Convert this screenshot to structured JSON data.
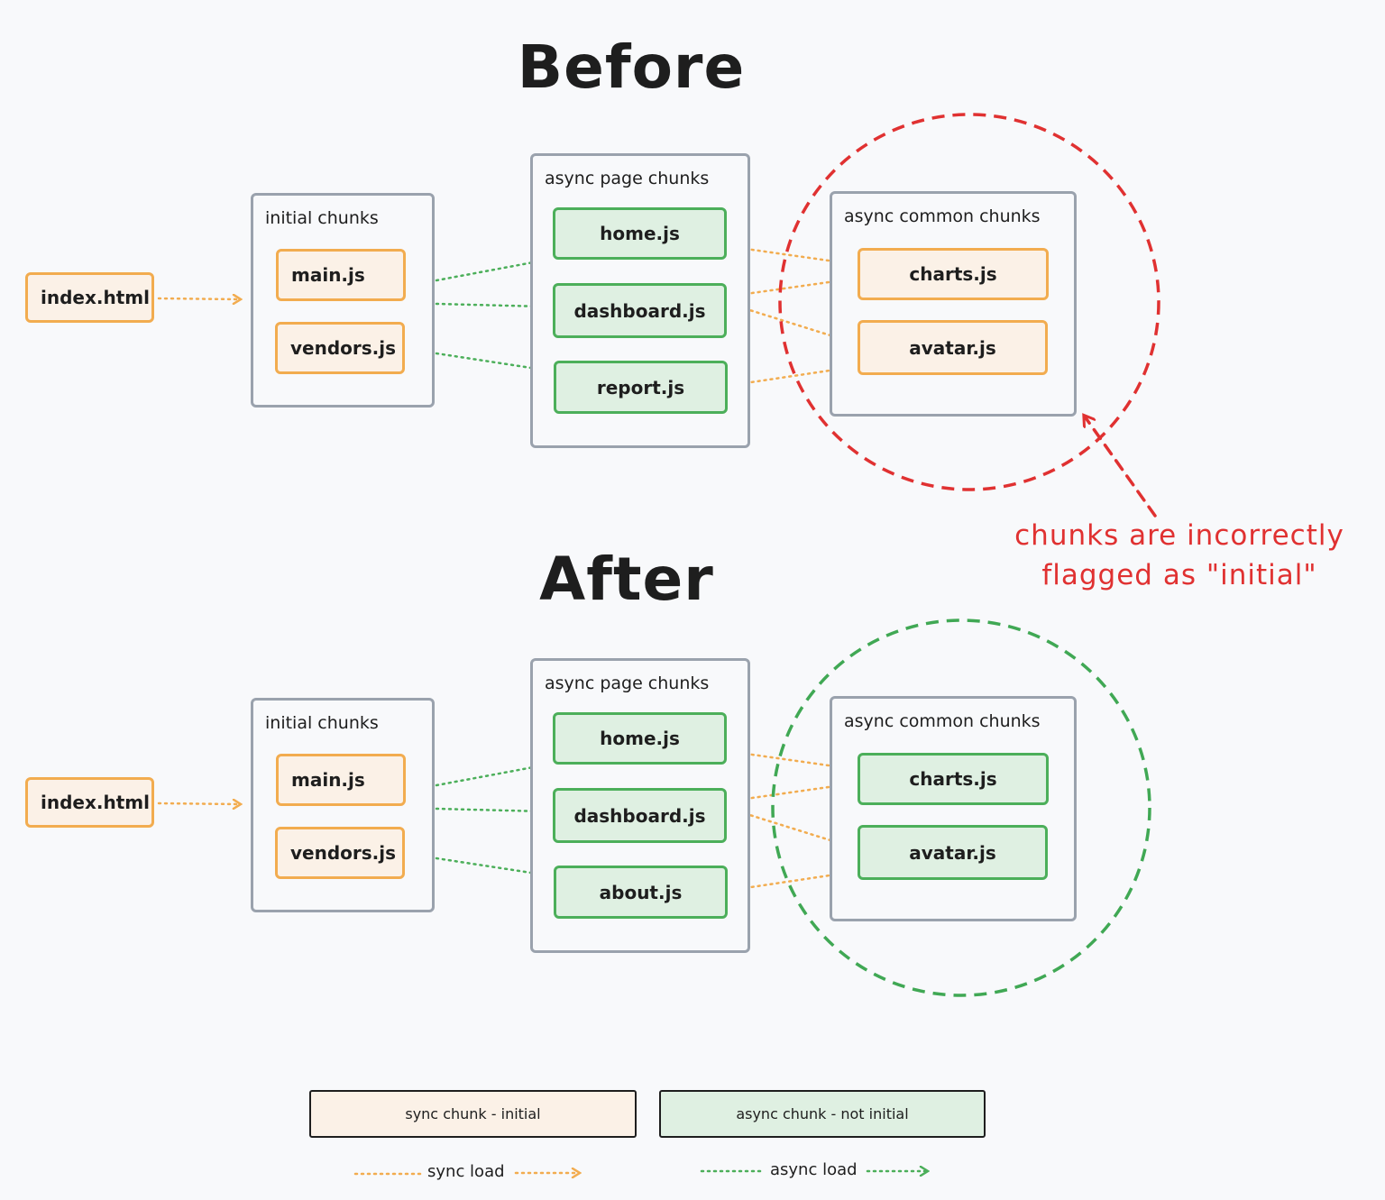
{
  "before": {
    "title": "Before",
    "entry": "index.html",
    "initial_group": {
      "label": "initial chunks",
      "chunks": [
        "main.js",
        "vendors.js"
      ]
    },
    "page_group": {
      "label": "async page chunks",
      "chunks": [
        "home.js",
        "dashboard.js",
        "report.js"
      ]
    },
    "common_group": {
      "label": "async common chunks",
      "chunks": [
        "charts.js",
        "avatar.js"
      ],
      "chunk_type": "sync"
    },
    "highlight_color": "#e03131",
    "annotation": {
      "line1": "chunks are incorrectly",
      "line2": "flagged as \"initial\""
    }
  },
  "after": {
    "title": "After",
    "entry": "index.html",
    "initial_group": {
      "label": "initial chunks",
      "chunks": [
        "main.js",
        "vendors.js"
      ]
    },
    "page_group": {
      "label": "async page chunks",
      "chunks": [
        "home.js",
        "dashboard.js",
        "about.js"
      ]
    },
    "common_group": {
      "label": "async common chunks",
      "chunks": [
        "charts.js",
        "avatar.js"
      ],
      "chunk_type": "async"
    },
    "highlight_color": "#40a854"
  },
  "legend": {
    "sync_chunk": "sync chunk - initial",
    "async_chunk": "async chunk - not initial",
    "sync_load": "sync load",
    "async_load": "async load"
  },
  "colors": {
    "sync_border": "#f2ac4f",
    "sync_fill": "#fbf1e7",
    "async_border": "#4caf5a",
    "async_fill": "#dff0e2",
    "group_border": "#9aa2ad",
    "error_red": "#e03131"
  }
}
